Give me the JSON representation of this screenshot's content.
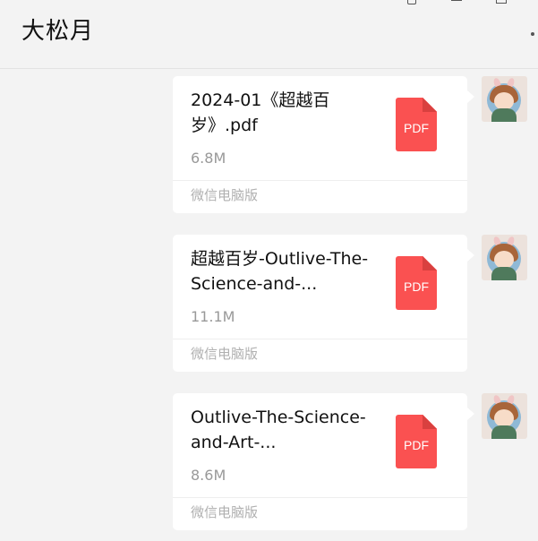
{
  "chat": {
    "title": "大松月",
    "window_controls": {
      "pin_icon": "pin-icon",
      "minimize_icon": "minimize-icon",
      "maximize_icon": "maximize-icon",
      "more_icon": "more-icon"
    }
  },
  "messages": [
    {
      "file_name": "2024-01《超越百岁》.pdf",
      "file_size": "6.8M",
      "source": "微信电脑版",
      "file_type": "PDF"
    },
    {
      "file_name": "超越百岁-Outlive-The-Science-and-...",
      "file_size": "11.1M",
      "source": "微信电脑版",
      "file_type": "PDF"
    },
    {
      "file_name": "Outlive-The-Science-and-Art-...",
      "file_size": "8.6M",
      "source": "微信电脑版",
      "file_type": "PDF"
    }
  ],
  "colors": {
    "background": "#f3f3f3",
    "bubble": "#ffffff",
    "pdf_icon": "#fa5151",
    "secondary_text": "#999999"
  }
}
